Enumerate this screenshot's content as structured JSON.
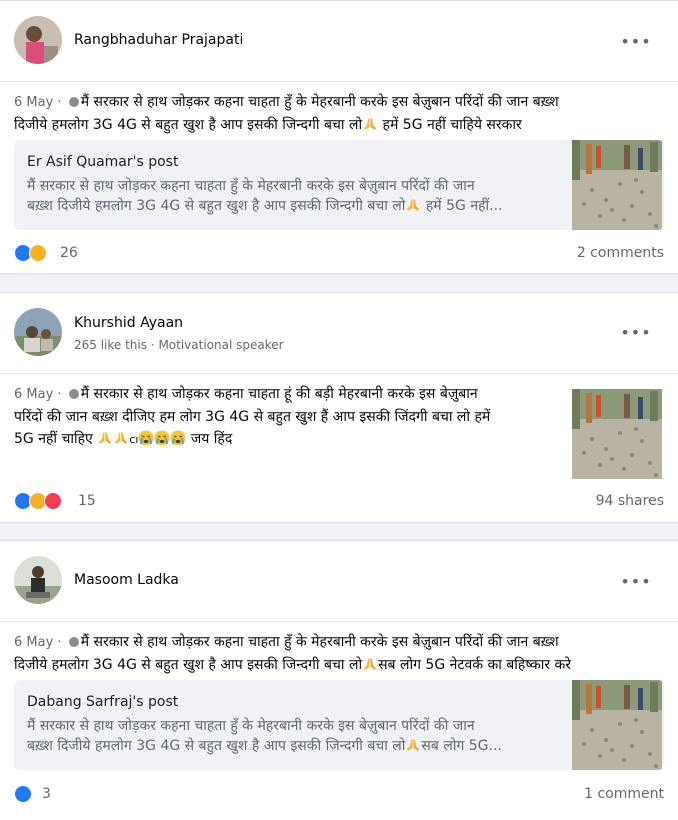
{
  "posts": [
    {
      "author": "Rangbhaduhar Prajapati",
      "subtitle": "",
      "date": "6 May",
      "text_line1": "मैं सरकार से हाथ जोड़कर कहना चाहता हुँ के मेहरबानी करके इस बेज़ुबान परिंदों की जान बख़्श",
      "text_line2a": "दिजीये हमलोग 3G 4G से बहुत खुश है आप इसकी जिन्दगी बचा लो",
      "text_line2b": " हमें 5G नहीं चाहिये सरकार",
      "shared_title": "Er Asif Quamar's post",
      "shared_line1": "मैं सरकार से हाथ जोड़कर कहना चाहता हुँ के मेहरबानी करके इस बेज़ुबान परिंदों की जान",
      "shared_line2a": "बख़्श दिजीये हमलोग 3G 4G से बहुत खुश है आप इसकी जिन्दगी बचा लो",
      "shared_line2b": " हमें 5G नहीं...",
      "reaction_count": "26",
      "right_stat": "2 comments"
    },
    {
      "author": "Khurshid Ayaan",
      "subtitle": "265 like this · Motivational speaker",
      "date": "6 May",
      "text_line1": "मैं सरकार से हाथ जोड़कर कहना चाहता हूं की बड़ी मेहरबानी करके इस बेज़ुबान",
      "text_line2": "परिंदों की जान बख़्श दीजिए हम लोग 3G 4G से बहुत खुश हैं आप इसकी जिंदगी बचा लो हमें",
      "text_line3a": "5G नहीं चाहिए",
      "text_line3b": "cı",
      "text_line3c": "जय हिंद",
      "reaction_count": "15",
      "right_stat": "94 shares"
    },
    {
      "author": "Masoom Ladka",
      "subtitle": "",
      "date": "6 May",
      "text_line1": "मैं सरकार से हाथ जोड़कर कहना चाहता हुँ के मेहरबानी करके इस बेज़ुबान परिंदों की जान बख़्श",
      "text_line2a": "दिजीये हमलोग 3G 4G से बहुत खुश है आप इसकी जिन्दगी बचा लो",
      "text_line2b": "सब लोग 5G नेटवर्क का बहिष्कार करे",
      "shared_title": "Dabang Sarfraj's post",
      "shared_line1": "मैं सरकार से हाथ जोड़कर कहना चाहता हुँ के मेहरबानी करके इस बेज़ुबान परिंदों की जान",
      "shared_line2a": "बख़्श दिजीये हमलोग 3G 4G से बहुत खुश है आप इसकी जिन्दगी बचा लो",
      "shared_line2b": "सब लोग 5G...",
      "reaction_count": "3",
      "right_stat": "1 comment"
    }
  ],
  "icons": {
    "more": "more-options-icon",
    "privacy": "globe-icon",
    "like": "like-reaction-icon",
    "sad": "sad-reaction-icon",
    "love": "love-reaction-icon",
    "pray": "folded-hands-emoji",
    "cry": "crying-face-emoji"
  },
  "colors": {
    "like": "#2078f4",
    "sad": "#f7b125",
    "love": "#f33e58",
    "secondary_text": "#65676b",
    "page_bg": "#f0f2f5"
  }
}
